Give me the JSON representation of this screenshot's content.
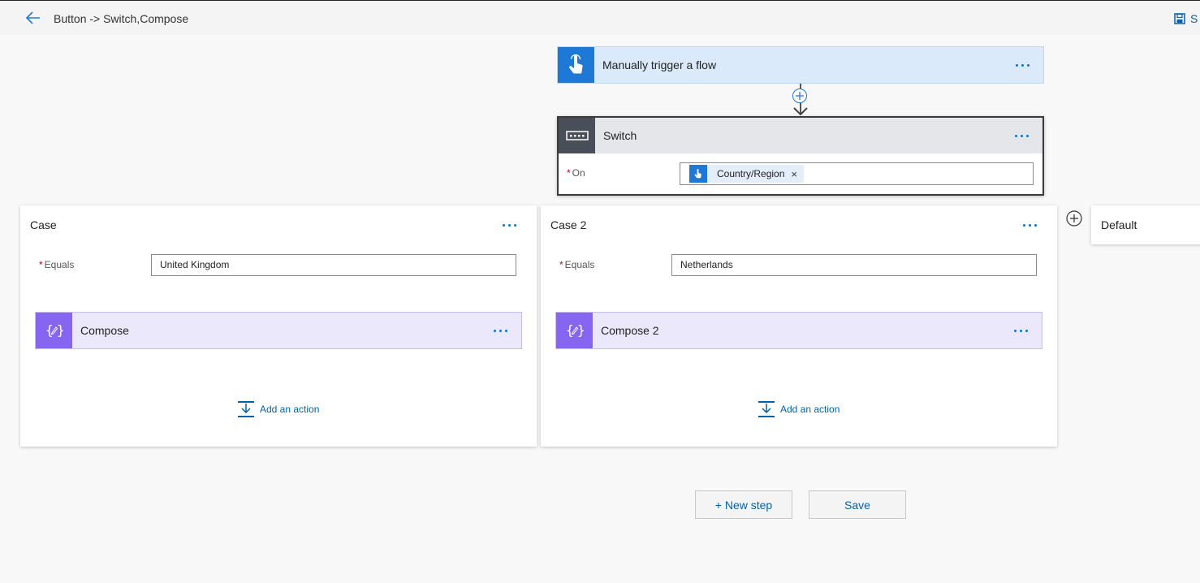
{
  "topbar": {
    "title": "Button -> Switch,Compose",
    "save_label": "S",
    "back_icon": "back-arrow-icon",
    "save_icon": "save-icon"
  },
  "trigger": {
    "label": "Manually trigger a flow",
    "icon": "touch-hand-icon"
  },
  "switch": {
    "label": "Switch",
    "icon": "switch-icon",
    "on_required": "*",
    "on_label": "On",
    "token_label": "Country/Region",
    "token_remove": "×"
  },
  "cases": [
    {
      "title": "Case",
      "equals_required": "*",
      "equals_label": "Equals",
      "equals_value": "United Kingdom",
      "compose_label": "Compose",
      "add_action": "Add an action"
    },
    {
      "title": "Case 2",
      "equals_required": "*",
      "equals_label": "Equals",
      "equals_value": "Netherlands",
      "compose_label": "Compose 2",
      "add_action": "Add an action"
    }
  ],
  "default_case": {
    "title": "Default"
  },
  "footer": {
    "new_step": "+ New step",
    "save": "Save"
  },
  "colors": {
    "accent": "#0078d4",
    "trigger_icon": "#1e78d6",
    "switch_icon": "#484f58",
    "compose_icon": "#8665f0",
    "required": "#cc0000"
  }
}
